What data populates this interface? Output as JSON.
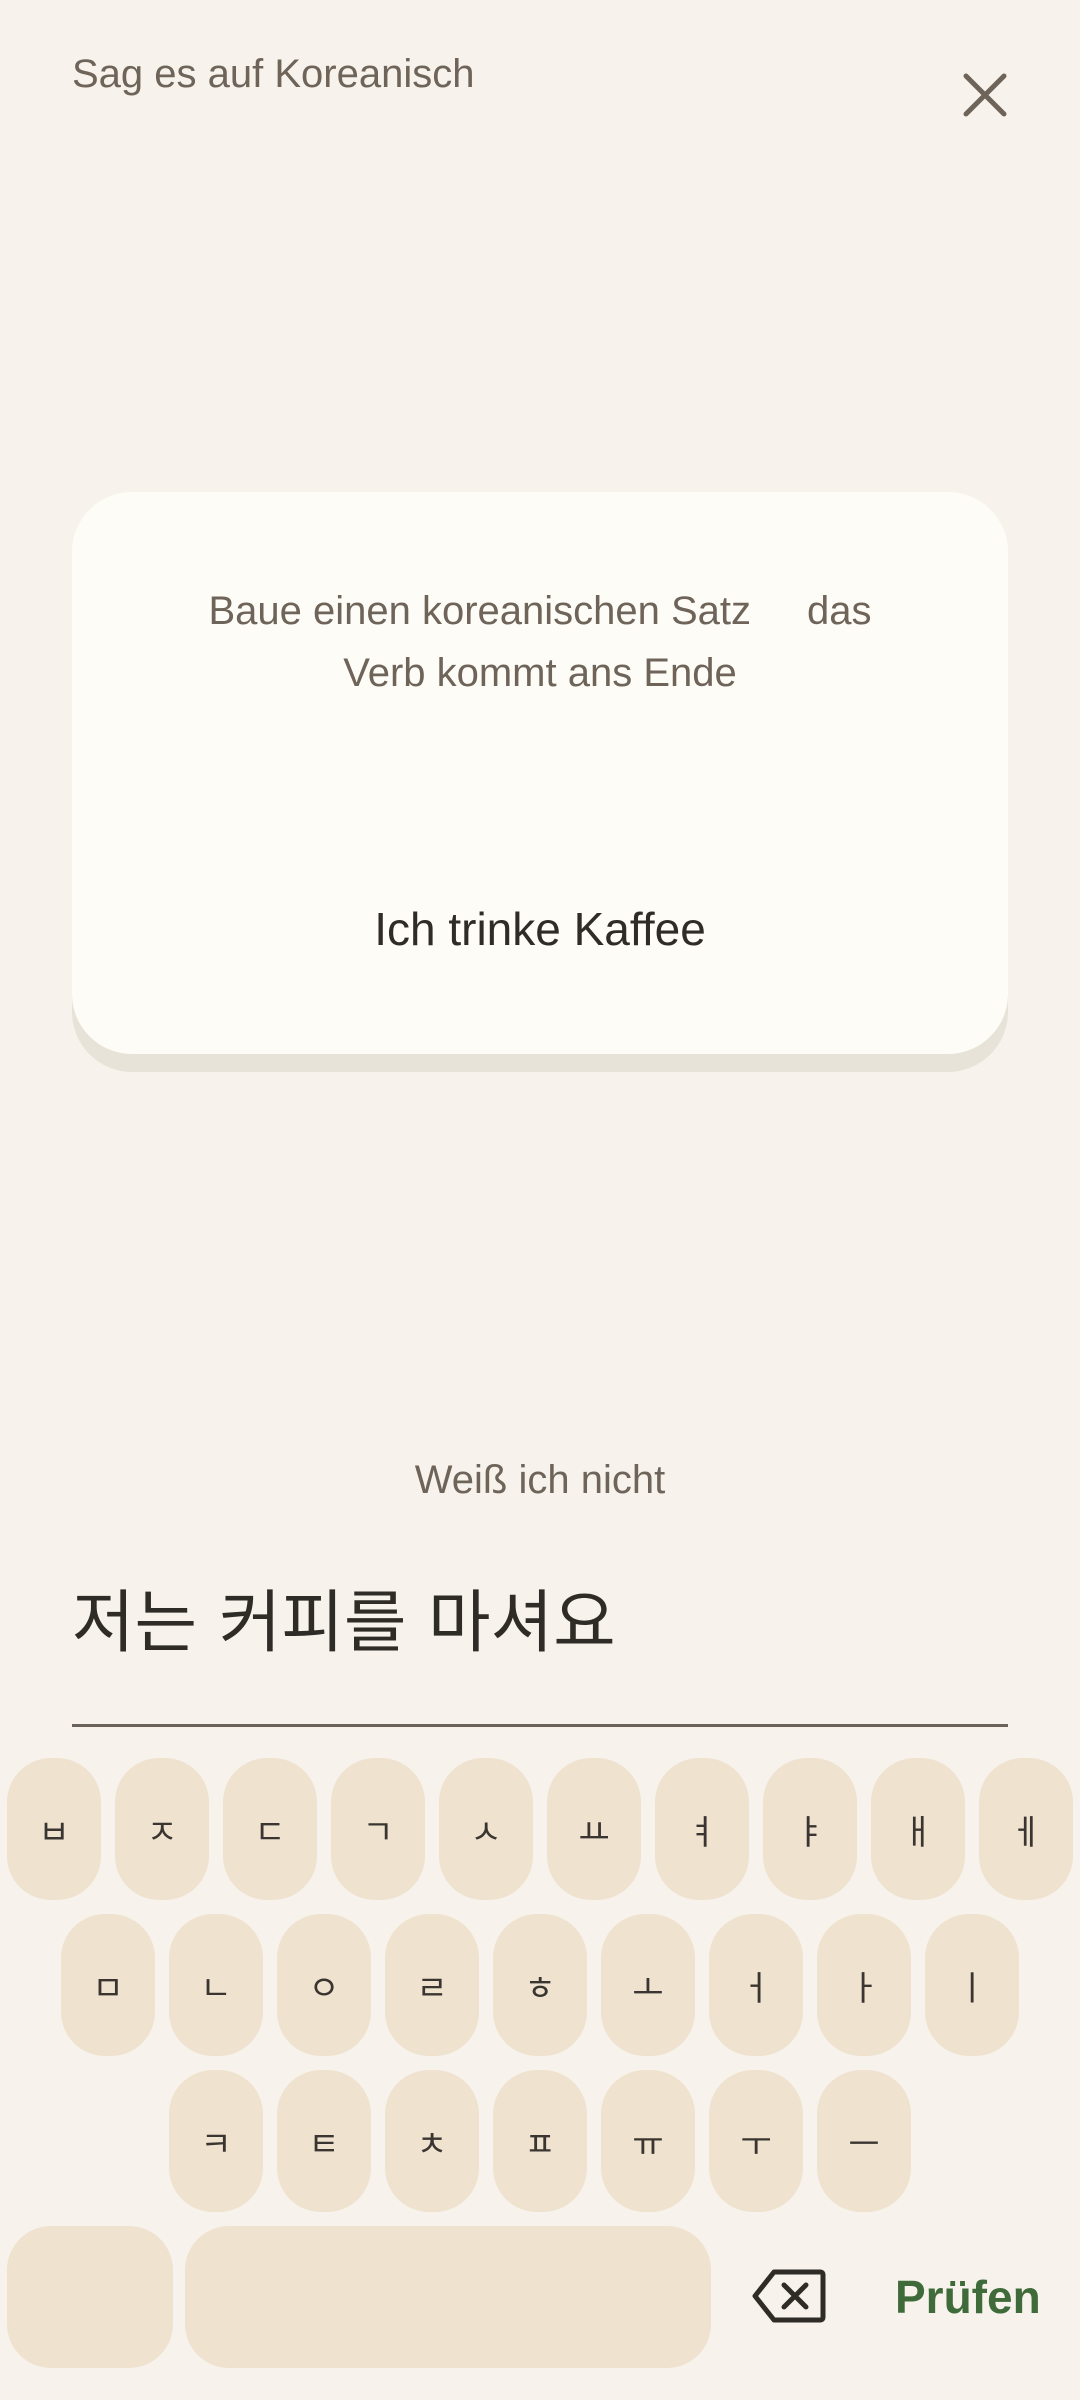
{
  "header": {
    "title": "Sag es auf Koreanisch",
    "close_icon": "close-icon"
  },
  "card": {
    "hint_line1": "Baue einen koreanischen Satz",
    "hint_line1b": "das",
    "hint_line2": "Verb kommt ans Ende",
    "phrase": "Ich trinke Kaffee"
  },
  "dont_know_label": "Weiß ich nicht",
  "answer": {
    "value": "저는 커피를 마셔요"
  },
  "keyboard": {
    "row1": [
      "ㅂ",
      "ㅈ",
      "ㄷ",
      "ㄱ",
      "ㅅ",
      "ㅛ",
      "ㅕ",
      "ㅑ",
      "ㅐ",
      "ㅔ"
    ],
    "row2": [
      "ㅁ",
      "ㄴ",
      "ㅇ",
      "ㄹ",
      "ㅎ",
      "ㅗ",
      "ㅓ",
      "ㅏ",
      "ㅣ"
    ],
    "row3": [
      "ㅋ",
      "ㅌ",
      "ㅊ",
      "ㅍ",
      "ㅠ",
      "ㅜ",
      "ㅡ"
    ],
    "backspace_icon": "backspace-icon",
    "check_label": "Prüfen"
  },
  "colors": {
    "background": "#f7f3ec",
    "key": "#efe2cf",
    "accent": "#3f6b3a"
  }
}
